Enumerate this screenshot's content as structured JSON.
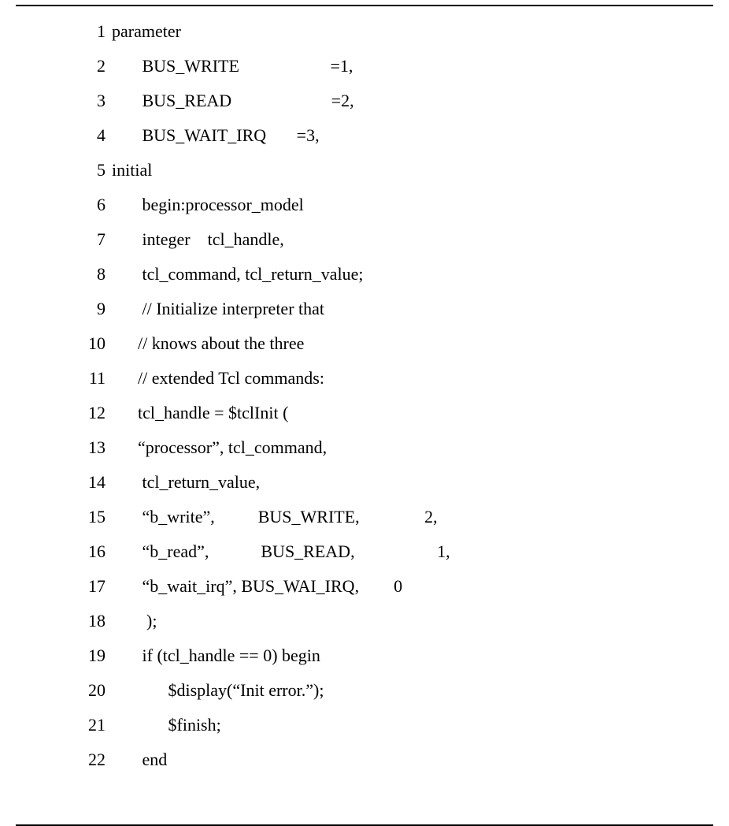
{
  "code": {
    "lines": [
      {
        "n": "1",
        "t": "parameter"
      },
      {
        "n": "2",
        "t": "       BUS_WRITE                     =1,"
      },
      {
        "n": "3",
        "t": "       BUS_READ                       =2,"
      },
      {
        "n": "4",
        "t": "       BUS_WAIT_IRQ       =3,"
      },
      {
        "n": "5",
        "t": "initial"
      },
      {
        "n": "6",
        "t": "       begin:processor_model"
      },
      {
        "n": "7",
        "t": "       integer    tcl_handle,"
      },
      {
        "n": "8",
        "t": "       tcl_command, tcl_return_value;"
      },
      {
        "n": "9",
        "t": "       // Initialize interpreter that"
      },
      {
        "n": "10",
        "t": "      // knows about the three"
      },
      {
        "n": "11",
        "t": "      // extended Tcl commands:"
      },
      {
        "n": "12",
        "t": "      tcl_handle = $tclInit ("
      },
      {
        "n": "13",
        "t": "      “processor”, tcl_command,"
      },
      {
        "n": "14",
        "t": "       tcl_return_value,"
      },
      {
        "n": "15",
        "t": "       “b_write”,          BUS_WRITE,               2,"
      },
      {
        "n": "16",
        "t": "       “b_read”,            BUS_READ,                   1,"
      },
      {
        "n": "17",
        "t": "       “b_wait_irq”, BUS_WAI_IRQ,        0"
      },
      {
        "n": "18",
        "t": "        );"
      },
      {
        "n": "19",
        "t": "       if (tcl_handle == 0) begin"
      },
      {
        "n": "20",
        "t": "             $display(“Init error.”);"
      },
      {
        "n": "21",
        "t": "             $finish;"
      },
      {
        "n": "22",
        "t": "       end"
      }
    ]
  }
}
